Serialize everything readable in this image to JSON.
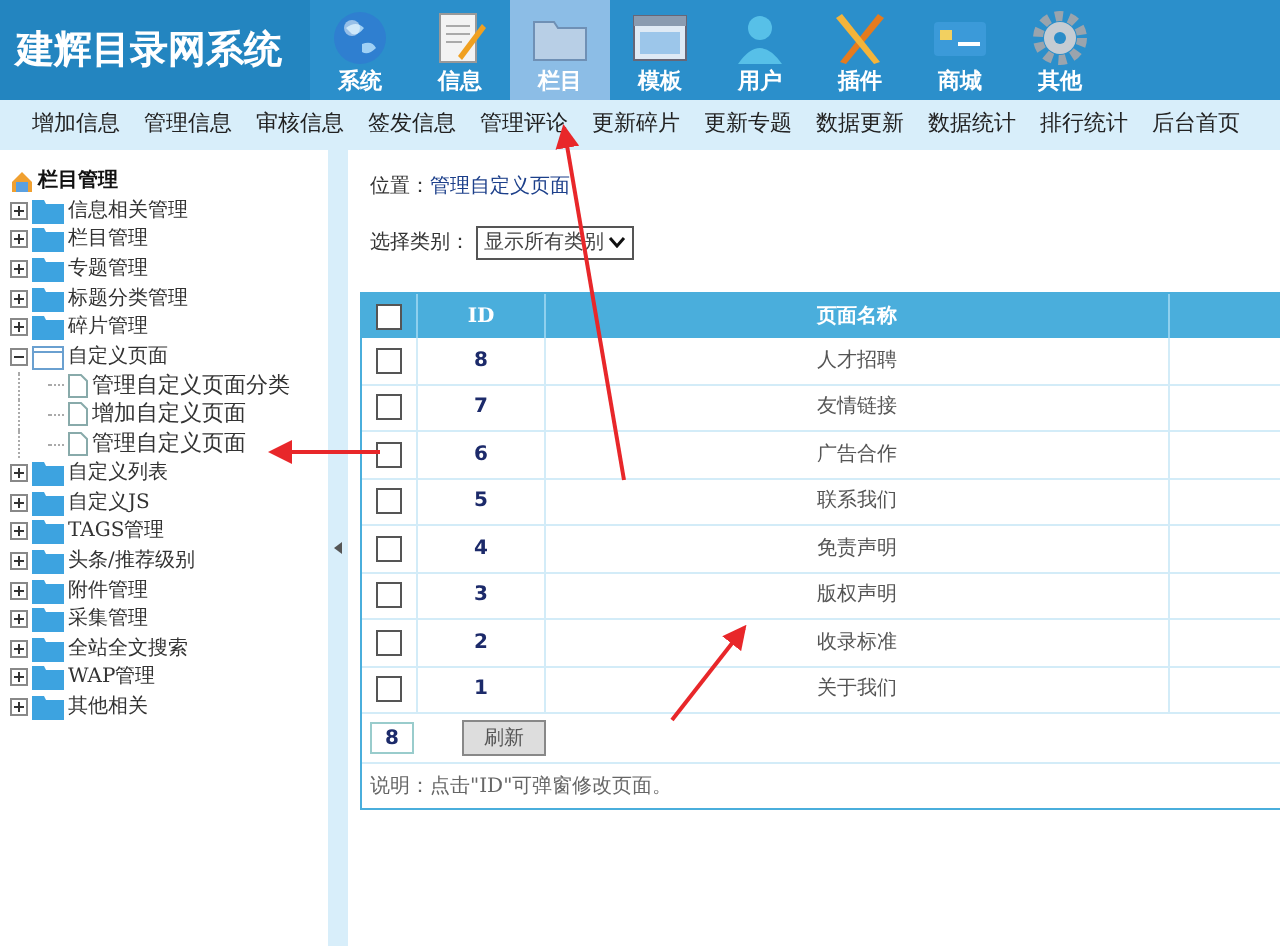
{
  "header": {
    "logo": "建辉目录网系统",
    "nav": [
      {
        "label": "系统",
        "kind": "globe",
        "selected": false
      },
      {
        "label": "信息",
        "kind": "document",
        "selected": false
      },
      {
        "label": "栏目",
        "kind": "folder",
        "selected": true
      },
      {
        "label": "模板",
        "kind": "window",
        "selected": false
      },
      {
        "label": "用户",
        "kind": "user",
        "selected": false
      },
      {
        "label": "插件",
        "kind": "tools",
        "selected": false
      },
      {
        "label": "商城",
        "kind": "card",
        "selected": false
      },
      {
        "label": "其他",
        "kind": "gear",
        "selected": false
      }
    ]
  },
  "submenu": [
    "增加信息",
    "管理信息",
    "审核信息",
    "签发信息",
    "管理评论",
    "更新碎片",
    "更新专题",
    "数据更新",
    "数据统计",
    "排行统计",
    "后台首页"
  ],
  "sidebar": {
    "title": "栏目管理",
    "items": [
      {
        "label": "信息相关管理",
        "expanded": false
      },
      {
        "label": "栏目管理",
        "expanded": false
      },
      {
        "label": "专题管理",
        "expanded": false
      },
      {
        "label": "标题分类管理",
        "expanded": false
      },
      {
        "label": "碎片管理",
        "expanded": false
      },
      {
        "label": "自定义页面",
        "expanded": true,
        "children": [
          {
            "label": "管理自定义页面分类"
          },
          {
            "label": "增加自定义页面"
          },
          {
            "label": "管理自定义页面"
          }
        ]
      },
      {
        "label": "自定义列表",
        "expanded": false
      },
      {
        "label": "自定义JS",
        "expanded": false
      },
      {
        "label": "TAGS管理",
        "expanded": false
      },
      {
        "label": "头条/推荐级别",
        "expanded": false
      },
      {
        "label": "附件管理",
        "expanded": false
      },
      {
        "label": "采集管理",
        "expanded": false
      },
      {
        "label": "全站全文搜索",
        "expanded": false
      },
      {
        "label": "WAP管理",
        "expanded": false
      },
      {
        "label": "其他相关",
        "expanded": false
      }
    ]
  },
  "breadcrumb": {
    "label": "位置：",
    "value": "管理自定义页面"
  },
  "filter": {
    "label": "选择类别：",
    "value": "显示所有类别"
  },
  "table": {
    "header_checked": false,
    "columns": [
      "ID",
      "页面名称"
    ],
    "rows": [
      {
        "checked": false,
        "id": "8",
        "name": "人才招聘"
      },
      {
        "checked": false,
        "id": "7",
        "name": "友情链接"
      },
      {
        "checked": false,
        "id": "6",
        "name": "广告合作"
      },
      {
        "checked": false,
        "id": "5",
        "name": "联系我们"
      },
      {
        "checked": false,
        "id": "4",
        "name": "免责声明"
      },
      {
        "checked": false,
        "id": "3",
        "name": "版权声明"
      },
      {
        "checked": false,
        "id": "2",
        "name": "收录标准"
      },
      {
        "checked": false,
        "id": "1",
        "name": "关于我们"
      }
    ]
  },
  "footer": {
    "count": "8",
    "button": "刷新"
  },
  "note": "说明：点击\"ID\"可弹窗修改页面。"
}
